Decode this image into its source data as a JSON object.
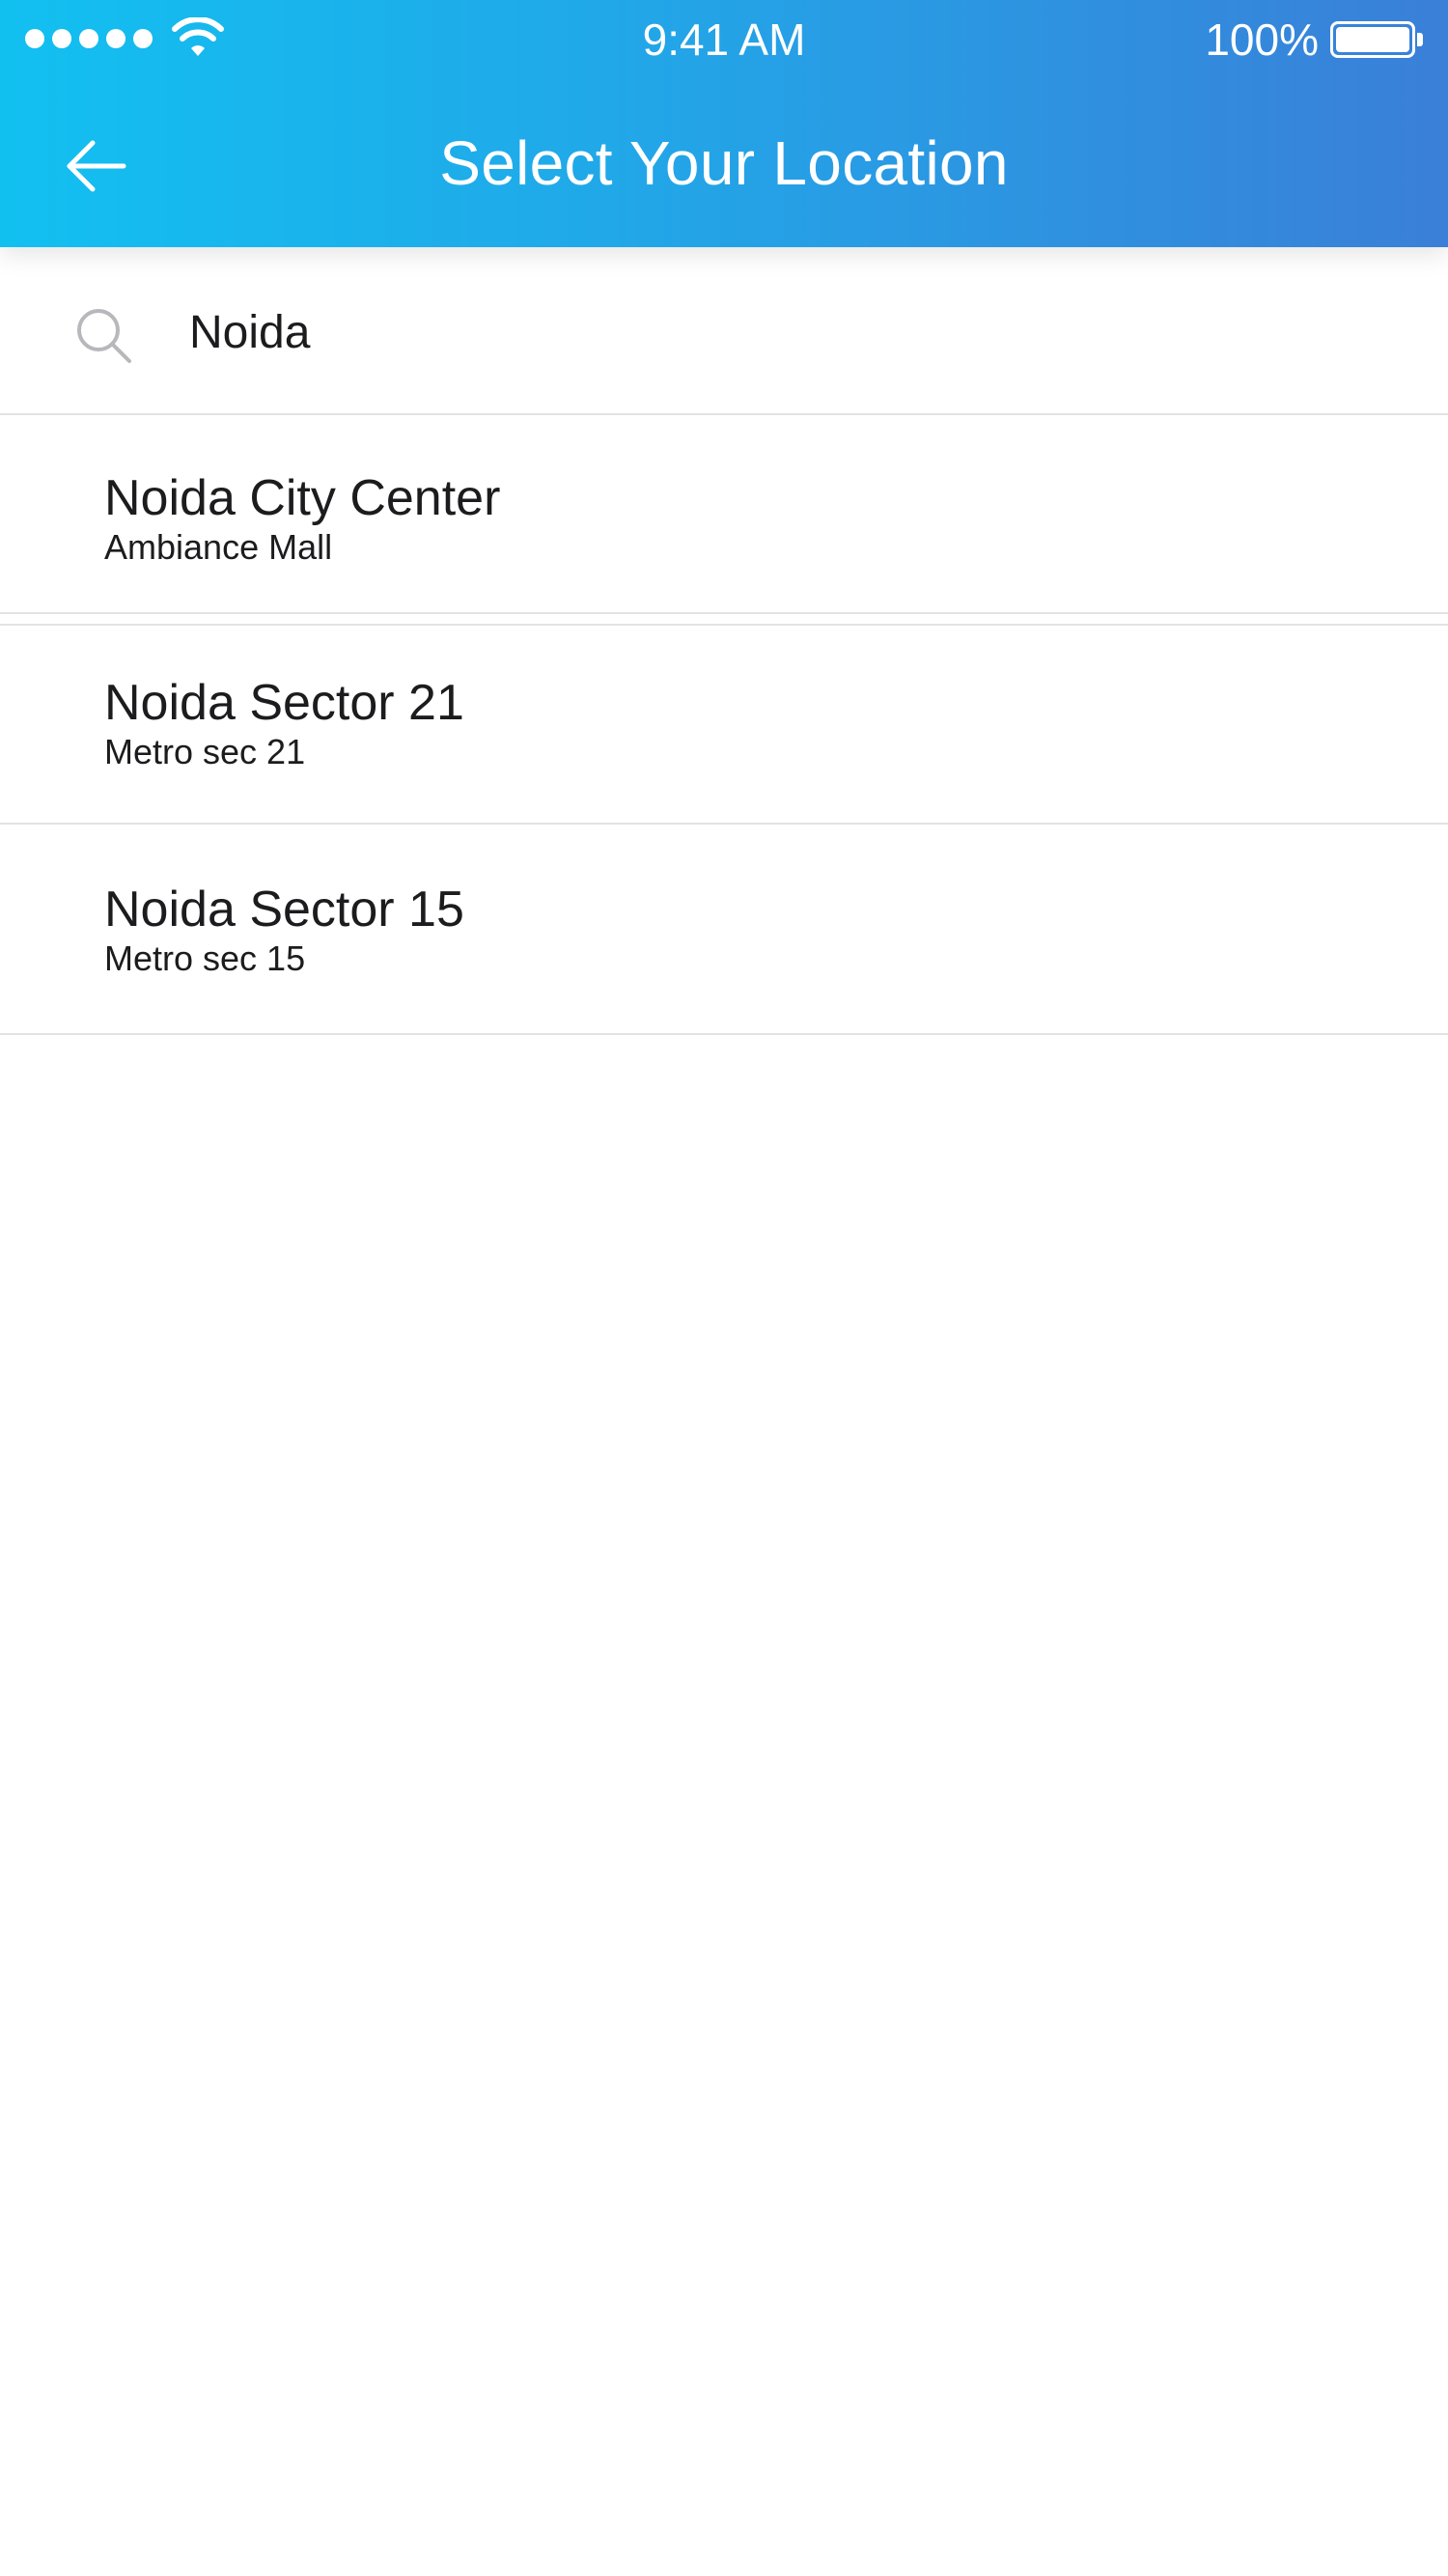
{
  "status_bar": {
    "time": "9:41 AM",
    "battery_percent": "100%",
    "signal_bars": 5,
    "battery_level": 1.0
  },
  "header": {
    "title": "Select Your Location",
    "back_icon": "arrow-left-icon"
  },
  "search": {
    "icon": "search-icon",
    "value": "Noida",
    "placeholder": ""
  },
  "results": [
    {
      "title": "Noida City Center",
      "subtitle": "Ambiance Mall"
    },
    {
      "title": "Noida Sector 21",
      "subtitle": "Metro sec 21"
    },
    {
      "title": "Noida Sector 15",
      "subtitle": "Metro sec 15"
    }
  ],
  "colors": {
    "header_gradient_start": "#12c0f0",
    "header_gradient_end": "#3a7fd8",
    "divider": "#e3e3e6",
    "text": "#1c1c1e",
    "icon_gray": "#b8b8bc"
  }
}
